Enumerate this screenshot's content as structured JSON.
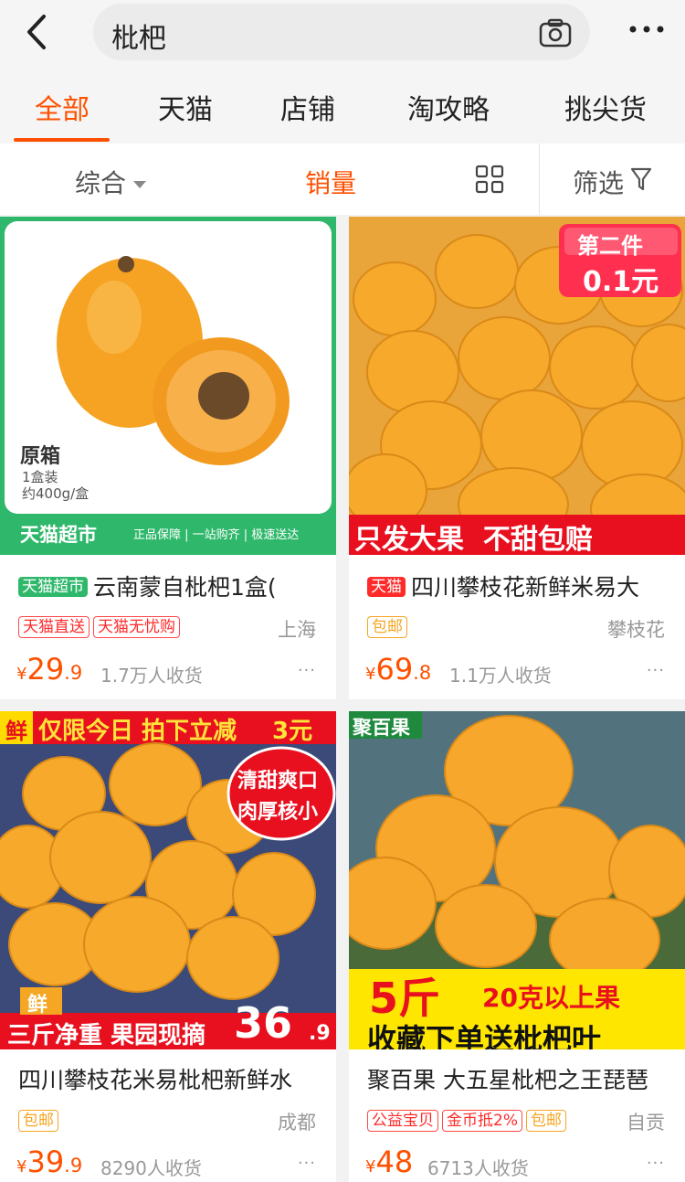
{
  "search": {
    "query": "枇杷"
  },
  "tabs": [
    {
      "label": "全部"
    },
    {
      "label": "天猫"
    },
    {
      "label": "店铺"
    },
    {
      "label": "淘攻略"
    },
    {
      "label": "挑尖货"
    }
  ],
  "sort": {
    "comprehensive": "综合",
    "sales": "销量",
    "filter": "筛选"
  },
  "colors": {
    "accent": "#ff5000",
    "tmall_green": "#2fb86b",
    "tmall_red": "#ff2a2a",
    "tag_yellow": "#f5a623"
  },
  "products": [
    {
      "badge": "天猫超市",
      "title": "云南蒙自枇杷1盒(",
      "tags": [
        "天猫直送",
        "天猫无忧购"
      ],
      "location": "上海",
      "currency": "¥",
      "price_int": "29",
      "price_dec": ".9",
      "sold": "1.7万人收货",
      "image": {
        "label": "原箱",
        "spec1": "1盒装",
        "spec2": "约400g/盒",
        "banner": "天猫超市",
        "banner_note": "正品保障 | 一站购齐 | 极速送达"
      }
    },
    {
      "badge": "天猫",
      "title": "四川攀枝花新鲜米易大",
      "tags": [
        "包邮"
      ],
      "location": "攀枝花",
      "currency": "¥",
      "price_int": "69",
      "price_dec": ".8",
      "sold": "1.1万人收货",
      "image": {
        "promo1": "第二件",
        "promo2": "0.1元",
        "banner": "只发大果  不甜包赔"
      }
    },
    {
      "title": "四川攀枝花米易枇杷新鲜水",
      "tags": [
        "包邮"
      ],
      "location": "成都",
      "currency": "¥",
      "price_int": "39",
      "price_dec": ".9",
      "sold": "8290人收货",
      "image": {
        "top": "仅限今日 拍下立减",
        "top_num": "3元",
        "corner": "鲜",
        "side1": "清甜爽口",
        "side2": "肉厚核小",
        "fresh": "鲜",
        "bottom": "三斤净重 果园现摘",
        "bottom_num": "36",
        "bottom_dec": ".9"
      }
    },
    {
      "title": "聚百果 大五星枇杷之王琵琶",
      "tags": [
        "公益宝贝",
        "金币抵2%",
        "包邮"
      ],
      "location": "自贡",
      "currency": "¥",
      "price_int": "48",
      "price_dec": "",
      "sold": "6713人收货",
      "image": {
        "brand": "聚百果",
        "line1a": "5斤",
        "line1b": "20克以上果",
        "line2": "收藏下单送枇杷叶"
      }
    }
  ],
  "more_glyph": "···"
}
